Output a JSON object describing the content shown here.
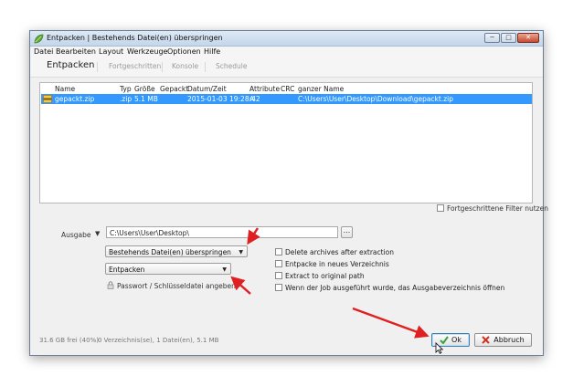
{
  "window": {
    "title": "Entpacken | Bestehends Datei(en) überspringen"
  },
  "titlebar_buttons": {
    "minimize": "─",
    "maximize": "□",
    "close": "✕"
  },
  "menu": [
    "Datei",
    "Bearbeiten",
    "Layout",
    "Werkzeuge",
    "Optionen",
    "Hilfe"
  ],
  "tabs": [
    "Entpacken",
    "Fortgeschritten",
    "Konsole",
    "Schedule"
  ],
  "file_list": {
    "columns": [
      "Name",
      "Typ",
      "Größe",
      "Gepackt",
      "Datum/Zeit",
      "Attribute",
      "CRC",
      "ganzer Name"
    ],
    "rows": [
      {
        "name": "gepackt.zip",
        "type": ".zip",
        "size": "5.1 MB",
        "packed": "",
        "date": "2015-01-03 19:28:42",
        "attr": "A",
        "crc": "",
        "fullname": "C:\\Users\\User\\Desktop\\Download\\gepackt.zip"
      }
    ]
  },
  "advanced_filter_label": "Fortgeschrittene Filter nutzen",
  "output": {
    "label": "Ausgabe",
    "path": "C:\\Users\\User\\Desktop\\",
    "browse_label": "...",
    "dropdown1": "Bestehends Datei(en) überspringen",
    "dropdown2": "Entpacken",
    "password_label": "Passwort / Schlüsseldatei angeben"
  },
  "options": [
    "Delete archives after extraction",
    "Entpacke in neues Verzeichnis",
    "Extract to original path",
    "Wenn der Job ausgeführt wurde, das Ausgabeverzeichnis öffnen"
  ],
  "status": {
    "free": "31.6 GB frei (40%)",
    "count": "0 Verzeichnis(se), 1 Datei(en), 5.1 MB"
  },
  "buttons": {
    "ok": "Ok",
    "cancel": "Abbruch"
  },
  "colors": {
    "selection": "#3399ff",
    "arrows": "#e02020",
    "ok_check": "#3aa33a",
    "cancel_x": "#d33020"
  }
}
